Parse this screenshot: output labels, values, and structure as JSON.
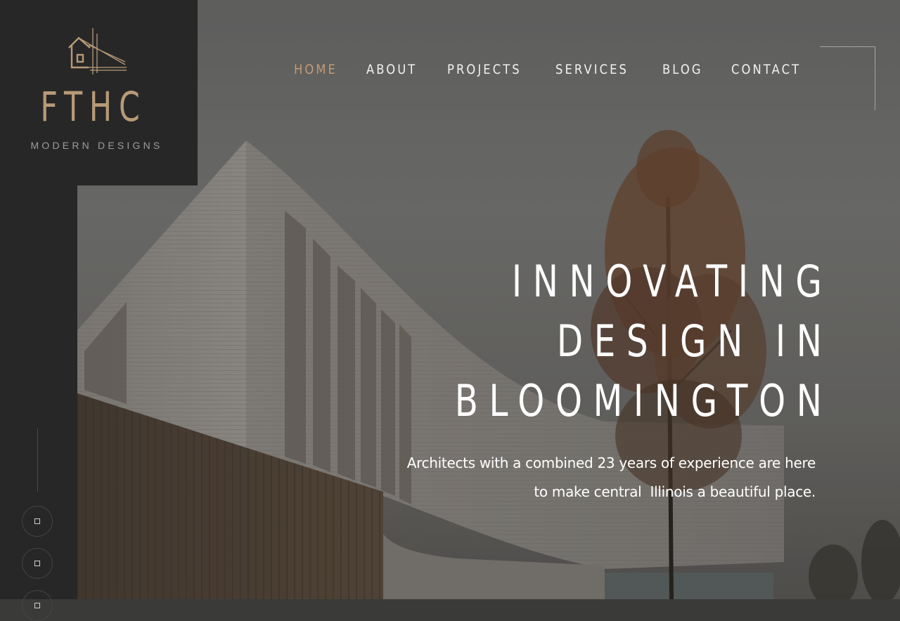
{
  "brand": {
    "title": "FTHC",
    "subtitle": "MODERN DESIGNS",
    "accent_color": "#b89a78"
  },
  "nav": {
    "items": [
      {
        "label": "HOME",
        "active": true
      },
      {
        "label": "ABOUT",
        "active": false
      },
      {
        "label": "PROJECTS",
        "active": false
      },
      {
        "label": "SERVICES",
        "active": false
      },
      {
        "label": "BLOG",
        "active": false
      },
      {
        "label": "CONTACT",
        "active": false
      }
    ]
  },
  "hero": {
    "headline_lines": [
      "INNOVATING",
      "DESIGN IN",
      "BLOOMINGTON"
    ],
    "tagline_lines": [
      "Architects with a combined 23 years of experience are here",
      "to make central  Illinois a beautiful place."
    ]
  },
  "rail": {
    "buttons": [
      {
        "icon": "square-icon"
      },
      {
        "icon": "square-icon"
      },
      {
        "icon": "square-icon"
      }
    ]
  }
}
